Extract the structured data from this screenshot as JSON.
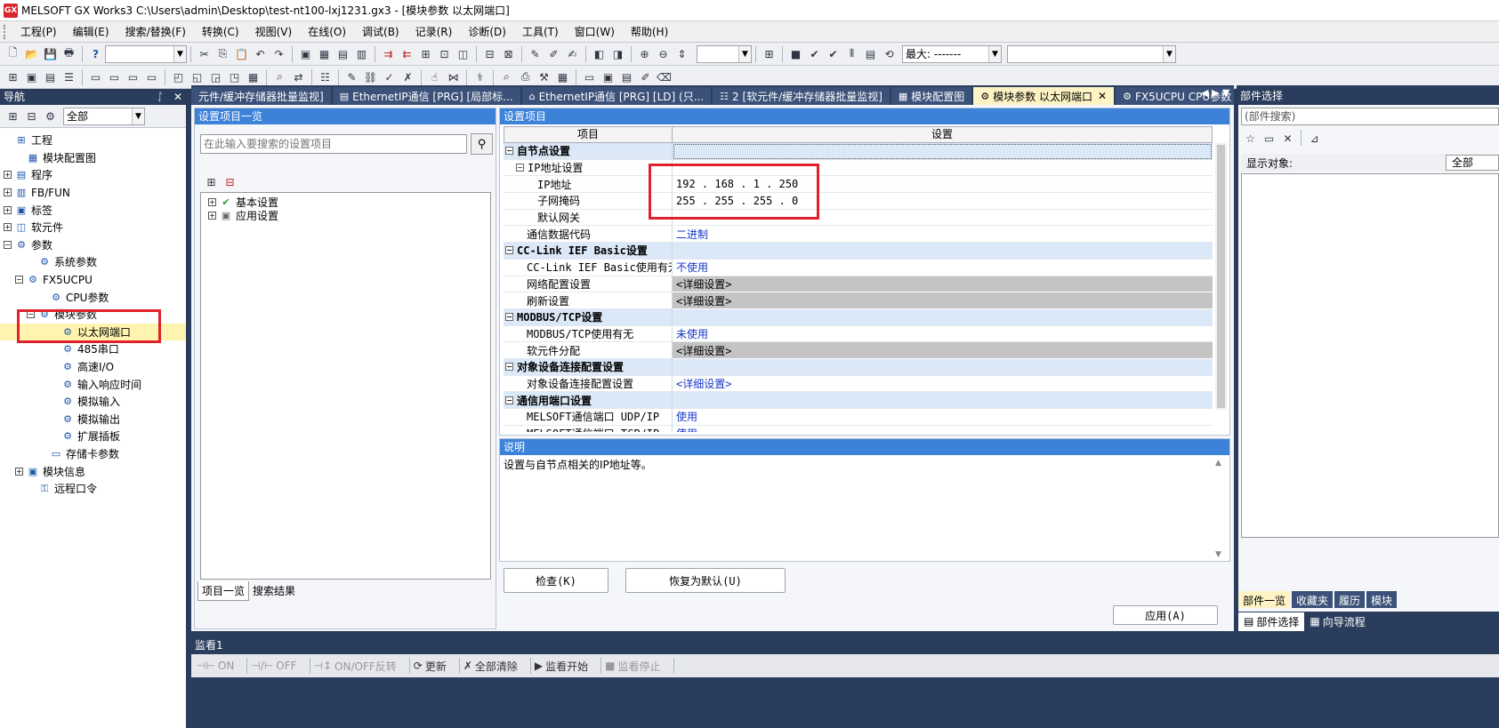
{
  "window": {
    "title": "MELSOFT GX Works3 C:\\Users\\admin\\Desktop\\test-nt100-lxj1231.gx3 - [模块参数 以太网端口]",
    "logo": "GX"
  },
  "menu": [
    "工程(P)",
    "编辑(E)",
    "搜索/替换(F)",
    "转换(C)",
    "视图(V)",
    "在线(O)",
    "调试(B)",
    "记录(R)",
    "诊断(D)",
    "工具(T)",
    "窗口(W)",
    "帮助(H)"
  ],
  "toolbar": {
    "zoom_label": "最大: -------"
  },
  "nav": {
    "title": "导航",
    "pin": "ᛇ",
    "close": "✕",
    "filter": "全部",
    "tree": [
      {
        "label": "工程",
        "level": 0,
        "exp": ""
      },
      {
        "label": "模块配置图",
        "level": 1,
        "exp": ""
      },
      {
        "label": "程序",
        "level": 0,
        "exp": "+"
      },
      {
        "label": "FB/FUN",
        "level": 0,
        "exp": "+"
      },
      {
        "label": "标签",
        "level": 0,
        "exp": "+"
      },
      {
        "label": "软元件",
        "level": 0,
        "exp": "+"
      },
      {
        "label": "参数",
        "level": 0,
        "exp": "−"
      },
      {
        "label": "系统参数",
        "level": 2,
        "exp": ""
      },
      {
        "label": "FX5UCPU",
        "level": 1,
        "exp": "−"
      },
      {
        "label": "CPU参数",
        "level": 3,
        "exp": ""
      },
      {
        "label": "模块参数",
        "level": 2,
        "exp": "−"
      },
      {
        "label": "以太网端口",
        "level": 4,
        "exp": "",
        "sel": true
      },
      {
        "label": "485串口",
        "level": 4,
        "exp": ""
      },
      {
        "label": "高速I/O",
        "level": 4,
        "exp": ""
      },
      {
        "label": "输入响应时间",
        "level": 4,
        "exp": ""
      },
      {
        "label": "模拟输入",
        "level": 4,
        "exp": ""
      },
      {
        "label": "模拟输出",
        "level": 4,
        "exp": ""
      },
      {
        "label": "扩展插板",
        "level": 4,
        "exp": ""
      },
      {
        "label": "存储卡参数",
        "level": 3,
        "exp": ""
      },
      {
        "label": "模块信息",
        "level": 1,
        "exp": "+"
      },
      {
        "label": "远程口令",
        "level": 2,
        "exp": ""
      }
    ]
  },
  "tabs": [
    {
      "label": "元件/缓冲存储器批量监视]",
      "icon": ""
    },
    {
      "label": "EthernetIP通信 [PRG] [局部标...",
      "icon": "▤"
    },
    {
      "label": "EthernetIP通信 [PRG] [LD] (只...",
      "icon": "⌂"
    },
    {
      "label": "2 [软元件/缓冲存储器批量监视]",
      "icon": "☷"
    },
    {
      "label": "模块配置图",
      "icon": "▦"
    },
    {
      "label": "模块参数 以太网端口",
      "icon": "⚙",
      "active": true
    },
    {
      "label": "FX5UCPU CPU参数",
      "icon": "⚙"
    }
  ],
  "tab_close": "✕",
  "listpanel": {
    "title": "设置项目一览",
    "search_placeholder": "在此输入要搜索的设置项目",
    "items": [
      "基本设置",
      "应用设置"
    ],
    "tab_list": "项目一览",
    "tab_search": "搜索结果"
  },
  "settings": {
    "title": "设置项目",
    "col_item": "项目",
    "col_setting": "设置",
    "rows": [
      {
        "k": "自节点设置",
        "v": "",
        "type": "cat"
      },
      {
        "k": "IP地址设置",
        "v": "",
        "type": "sub"
      },
      {
        "k": "IP地址",
        "v": "192 . 168 .   1 . 250",
        "type": "item2"
      },
      {
        "k": "子网掩码",
        "v": "255 . 255 . 255 .   0",
        "type": "item2"
      },
      {
        "k": "默认网关",
        "v": "",
        "type": "item2"
      },
      {
        "k": "通信数据代码",
        "v": "二进制",
        "type": "item1",
        "blue": true
      },
      {
        "k": "CC-Link IEF Basic设置",
        "v": "",
        "type": "cat"
      },
      {
        "k": "CC-Link IEF Basic使用有无",
        "v": "不使用",
        "type": "item1",
        "blue": true
      },
      {
        "k": "网络配置设置",
        "v": "<详细设置>",
        "type": "item1",
        "gray": true
      },
      {
        "k": "刷新设置",
        "v": "<详细设置>",
        "type": "item1",
        "gray": true
      },
      {
        "k": "MODBUS/TCP设置",
        "v": "",
        "type": "cat"
      },
      {
        "k": "MODBUS/TCP使用有无",
        "v": "未使用",
        "type": "item1",
        "blue": true
      },
      {
        "k": "软元件分配",
        "v": "<详细设置>",
        "type": "item1",
        "gray": true
      },
      {
        "k": "对象设备连接配置设置",
        "v": "",
        "type": "cat"
      },
      {
        "k": "对象设备连接配置设置",
        "v": "<详细设置>",
        "type": "item1",
        "blue": true
      },
      {
        "k": "通信用端口设置",
        "v": "",
        "type": "cat"
      },
      {
        "k": "MELSOFT通信端口 UDP/IP",
        "v": "使用",
        "type": "item1",
        "blue": true
      },
      {
        "k": "MELSOFT通信端口 TCP/IP",
        "v": "使用",
        "type": "item1",
        "blue": true
      }
    ]
  },
  "description": {
    "title": "说明",
    "text": "设置与自节点相关的IP地址等。"
  },
  "buttons": {
    "check": "检查(K)",
    "restore": "恢复为默认(U)",
    "apply": "应用(A)"
  },
  "rightpane": {
    "title": "部件选择",
    "search_placeholder": "(部件搜索)",
    "display_label": "显示对象:",
    "display_value": "全部",
    "tabs": [
      "部件一览",
      "收藏夹",
      "履历",
      "模块"
    ],
    "bottom": [
      "部件选择",
      "向导流程"
    ]
  },
  "monitor": {
    "title": "监看1",
    "buttons": [
      {
        "label": "ON",
        "icon": "⊣⊢",
        "dis": true
      },
      {
        "label": "OFF",
        "icon": "⊣/⊢",
        "dis": true
      },
      {
        "label": "ON/OFF反转",
        "icon": "⊣↕",
        "dis": true
      },
      {
        "label": "更新",
        "icon": "⟳",
        "dis": false
      },
      {
        "label": "全部清除",
        "icon": "✗",
        "dis": false
      },
      {
        "label": "监看开始",
        "icon": "▶",
        "dis": false
      },
      {
        "label": "监看停止",
        "icon": "■",
        "dis": true
      }
    ]
  }
}
